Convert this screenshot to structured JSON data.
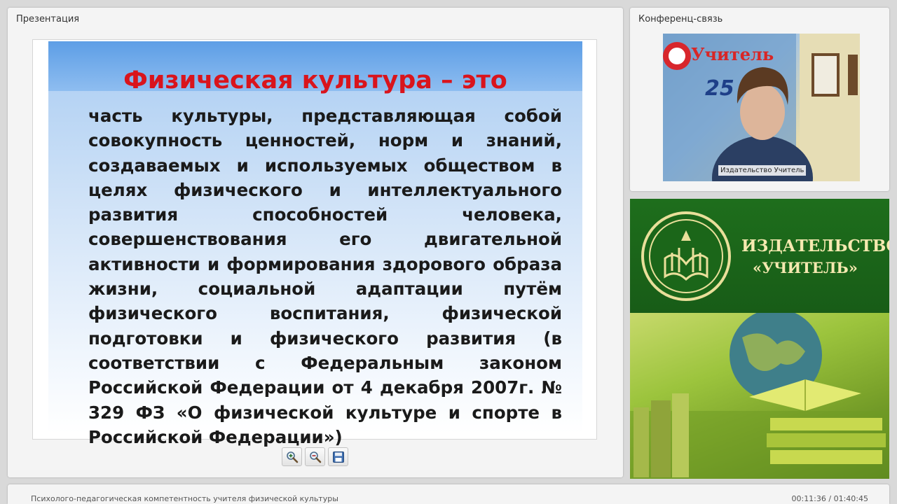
{
  "presentation": {
    "panel_title": "Презентация",
    "slide": {
      "title": "Физическая культура – это",
      "body": "часть культуры, представляющая собой совокупность ценностей, норм и знаний, создаваемых и используемых обществом в целях физического и интеллектуального развития способностей человека, совершенствования его двигательной активности и формирования здорового образа жизни, социальной адаптации путём физического воспитания, физической подготовки и физического развития (в соответствии с Федеральным законом Российской Федерации от 4 декабря 2007г. № 329 ФЗ «О физической культуре и спорте в Российской Федерации»)"
    },
    "tools": [
      {
        "name": "zoom-in",
        "icon": "zoom-in-icon"
      },
      {
        "name": "zoom-out",
        "icon": "zoom-out-icon"
      },
      {
        "name": "save",
        "icon": "floppy-disk-icon"
      }
    ]
  },
  "conference": {
    "panel_title": "Конференц-связь",
    "participant_name": "Издательство Учитель"
  },
  "banner": {
    "line1": "ИЗДАТЕЛЬСТВО",
    "line2": "«УЧИТЕЛЬ»"
  },
  "footer": {
    "course_title": "Психолого-педагогическая компетентность учителя физической культуры",
    "time": "00:11:36 / 01:40:45"
  },
  "colors": {
    "slide_title": "#d9141c",
    "slide_header": "#5d9ee6",
    "banner_green": "#1e6e1c",
    "banner_text": "#f5e9b0"
  }
}
